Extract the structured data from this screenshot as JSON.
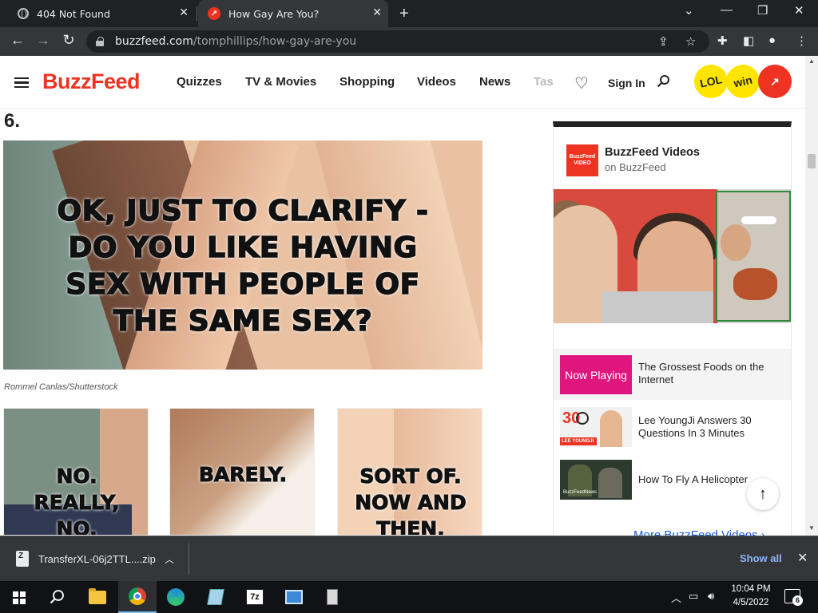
{
  "browser": {
    "tabs": [
      {
        "title": "404 Not Found",
        "icon": "globe-icon"
      },
      {
        "title": "How Gay Are You?",
        "icon": "buzzfeed-trending-icon"
      }
    ],
    "new_tab": "+",
    "url_host": "buzzfeed.com",
    "url_path": "/tomphillips/how-gay-are-you"
  },
  "header": {
    "logo": "BuzzFeed",
    "nav": [
      "Quizzes",
      "TV & Movies",
      "Shopping",
      "Videos",
      "News",
      "Tas"
    ],
    "sign_in": "Sign In",
    "badges": {
      "lol": "LOL",
      "win": "win",
      "trend": "↗"
    }
  },
  "question": {
    "number": "6.",
    "text": "OK, JUST TO CLARIFY - DO YOU LIKE HAVING SEX WITH PEOPLE OF THE SAME SEX?",
    "lines": [
      "OK, JUST TO CLARIFY -",
      "DO YOU LIKE HAVING",
      "SEX WITH PEOPLE OF",
      "THE SAME SEX?"
    ],
    "credit": "Rommel Canlas/Shutterstock"
  },
  "answers": [
    {
      "lines": [
        "NO.",
        "REALLY,",
        "NO."
      ]
    },
    {
      "lines": [
        "BARELY."
      ]
    },
    {
      "lines": [
        "SORT OF.",
        "NOW AND",
        "THEN."
      ]
    }
  ],
  "sidebar": {
    "channel": "BuzzFeed Videos",
    "sub": "on BuzzFeed",
    "logo_text": "BuzzFeed VIDEO",
    "now_playing": "Now Playing",
    "videos": [
      {
        "title": "The Grossest Foods on the Internet"
      },
      {
        "title": "Lee YoungJi Answers 30 Questions In 3 Minutes",
        "thumb_num": "30",
        "thumb_label": "LEE YOUNGJI"
      },
      {
        "title": "How To Fly A Helicopter",
        "thumb_label": "BuzzFeedNews"
      }
    ],
    "more_link": "More BuzzFeed Videos ›"
  },
  "downloads": {
    "file": "TransferXL-06j2TTL....zip",
    "show_all": "Show all"
  },
  "taskbar": {
    "time": "10:04 PM",
    "date": "4/5/2022",
    "notification_count": "6",
    "zip_app_label": "7z"
  }
}
